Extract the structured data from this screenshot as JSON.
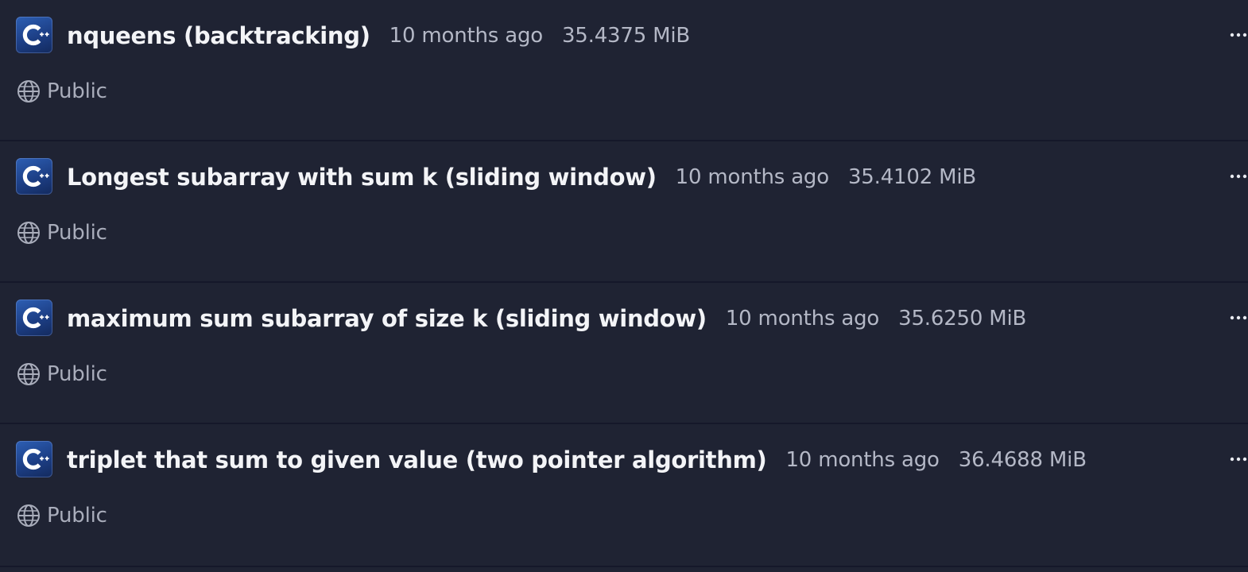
{
  "snippets": [
    {
      "title": "nqueens (backtracking)",
      "age": "10 months ago",
      "size": "35.4375 MiB",
      "visibility": "Public",
      "language_icon": "cpp-icon"
    },
    {
      "title": "Longest subarray with sum k (sliding window)",
      "age": "10 months ago",
      "size": "35.4102 MiB",
      "visibility": "Public",
      "language_icon": "cpp-icon"
    },
    {
      "title": "maximum sum subarray of size k (sliding window)",
      "age": "10 months ago",
      "size": "35.6250 MiB",
      "visibility": "Public",
      "language_icon": "cpp-icon"
    },
    {
      "title": "triplet that sum to given value (two pointer algorithm)",
      "age": "10 months ago",
      "size": "36.4688 MiB",
      "visibility": "Public",
      "language_icon": "cpp-icon"
    }
  ],
  "icons": {
    "visibility": "globe-icon",
    "actions": "more-options-icon"
  },
  "colors": {
    "background": "#1f2333",
    "divider": "#15182a",
    "title": "#f3f4f7",
    "meta": "#b4b8c6",
    "cpp_icon": "#2d5fb4"
  }
}
